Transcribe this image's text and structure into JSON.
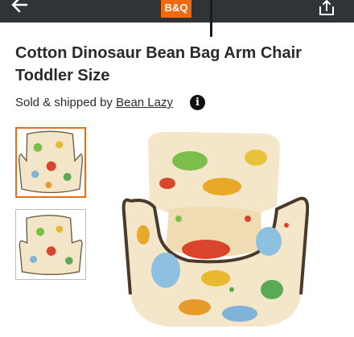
{
  "header": {
    "logo_text": "B&Q",
    "brand_color": "#f26a10",
    "bar_color": "#2f3437",
    "back_icon": "arrow-left-icon",
    "share_icon": "share-icon"
  },
  "product": {
    "title": "Cotton Dinosaur Bean Bag Arm Chair Toddler Size",
    "sold_by_prefix": "Sold & shipped by",
    "seller_name": "Bean Lazy",
    "info_icon": "i"
  },
  "gallery": {
    "thumbnails": [
      "thumbnail-front",
      "thumbnail-angle"
    ],
    "selected_index": 0
  }
}
